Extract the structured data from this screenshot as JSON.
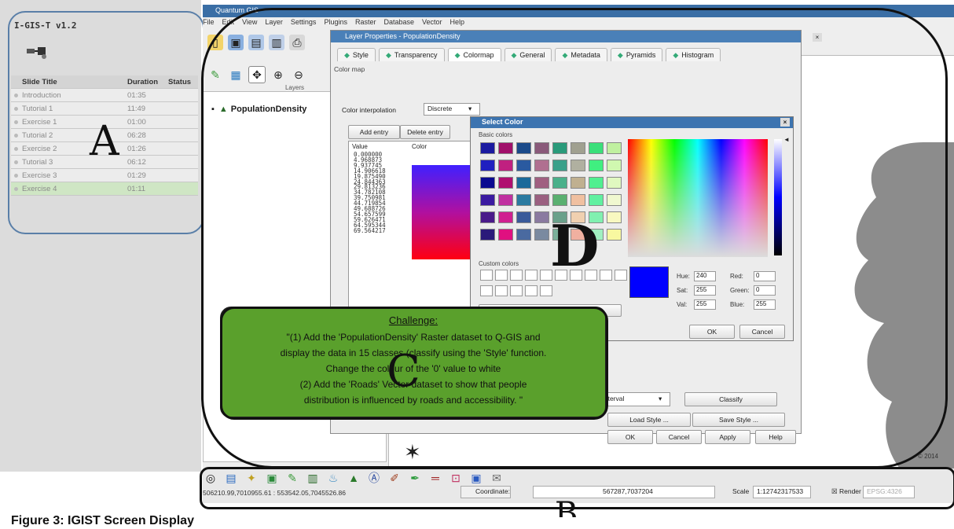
{
  "igist": {
    "version": "I-GIS-T v1.2",
    "columns": [
      "Slide Title",
      "Duration",
      "Status"
    ],
    "slides": [
      {
        "title": "Introduction",
        "duration": "01:35"
      },
      {
        "title": "Tutorial 1",
        "duration": "11:49"
      },
      {
        "title": "Exercise 1",
        "duration": "01:00"
      },
      {
        "title": "Tutorial 2",
        "duration": "06:28"
      },
      {
        "title": "Exercise 2",
        "duration": "01:26"
      },
      {
        "title": "Tutorial 3",
        "duration": "06:12"
      },
      {
        "title": "Exercise 3",
        "duration": "01:29"
      },
      {
        "title": "Exercise 4",
        "duration": "01:11"
      }
    ],
    "selected_index": 7
  },
  "qgis": {
    "title": "Quantum GIS",
    "menu": [
      "File",
      "Edit",
      "View",
      "Layer",
      "Settings",
      "Plugins",
      "Raster",
      "Database",
      "Vector",
      "Help"
    ],
    "layers_header": "Layers",
    "layer_name": "PopulationDensity"
  },
  "layer_properties": {
    "title": "Layer Properties - PopulationDensity",
    "tabs": [
      "Style",
      "Transparency",
      "Colormap",
      "General",
      "Metadata",
      "Pyramids",
      "Histogram"
    ],
    "active_tab": "Colormap",
    "section": "Color map",
    "interp_label": "Color interpolation",
    "interp_value": "Discrete",
    "add_entry": "Add entry",
    "delete_entry": "Delete entry",
    "col_value": "Value",
    "col_color": "Color",
    "values": [
      "0.000000",
      "4.968873",
      "9.937745",
      "14.906618",
      "19.875490",
      "24.844363",
      "29.813236",
      "34.782108",
      "39.750981",
      "44.719854",
      "49.688726",
      "54.657599",
      "59.626471",
      "64.595344",
      "69.564217"
    ],
    "mode_value": "al interval",
    "classify": "Classify",
    "load_style": "Load Style ...",
    "save_style": "Save Style ...",
    "ok": "OK",
    "cancel": "Cancel",
    "apply": "Apply",
    "help": "Help"
  },
  "select_color": {
    "title": "Select Color",
    "basic_label": "Basic colors",
    "custom_label": "Custom colors",
    "hue_label": "Hue:",
    "hue": "240",
    "sat_label": "Sat:",
    "sat": "255",
    "val_label": "Val:",
    "val": "255",
    "red_label": "Red:",
    "red": "0",
    "green_label": "Green:",
    "green": "0",
    "blue_label": "Blue:",
    "blue": "255",
    "ok": "OK",
    "cancel": "Cancel",
    "swatches": [
      "#1a1aa0",
      "#a0106a",
      "#1a4a8a",
      "#8a5a7a",
      "#2a9a7a",
      "#a0a090",
      "#3adf7a",
      "#c0f0a0",
      "#2020c0",
      "#c02080",
      "#2a5aa0",
      "#b07090",
      "#3aa08a",
      "#b0b0a0",
      "#40ef80",
      "#d0f8b0",
      "#0a0a90",
      "#b01070",
      "#1a6a9a",
      "#a06080",
      "#4ab08a",
      "#c0b090",
      "#50ef90",
      "#e0f8c0",
      "#3a1aa0",
      "#c030a0",
      "#2a7aa0",
      "#9a6080",
      "#5ab070",
      "#f0c0a0",
      "#60f0a0",
      "#f0f8d0",
      "#4a1a8a",
      "#d02090",
      "#3a5a9a",
      "#8a7aa0",
      "#6aa08a",
      "#f0d0b0",
      "#80f0b0",
      "#f8f8c0",
      "#2a1a7a",
      "#e01080",
      "#4a6aa0",
      "#7a8aa0",
      "#7ab09a",
      "#f0b0a0",
      "#a0f0c0",
      "#f8f8a0"
    ]
  },
  "challenge": {
    "title": "Challenge:",
    "lines": [
      "\"(1) Add the 'PopulationDensity' Raster dataset to Q-GIS and",
      "display the data in 15 classes (classify using the 'Style' function.",
      "Change the colour of the '0' value to white",
      "(2) Add the 'Roads' Vector dataset to show that people",
      "distribution is influenced by roads and accessibility. \""
    ]
  },
  "statusbar": {
    "coords": "506210.99,7010955.61 : 553542.05,7045526.86",
    "coordinate_label": "Coordinate:",
    "coordinate_value": "567287,7037204",
    "scale_label": "Scale",
    "scale_value": "1:127423175​33",
    "render_label": "Render",
    "epsg": "EPSG:4326"
  },
  "annotations": {
    "a": "A",
    "b": "B",
    "c": "C",
    "d": "D"
  },
  "copyright": "© 2014",
  "caption": "Figure 3: IGIST Screen Display"
}
